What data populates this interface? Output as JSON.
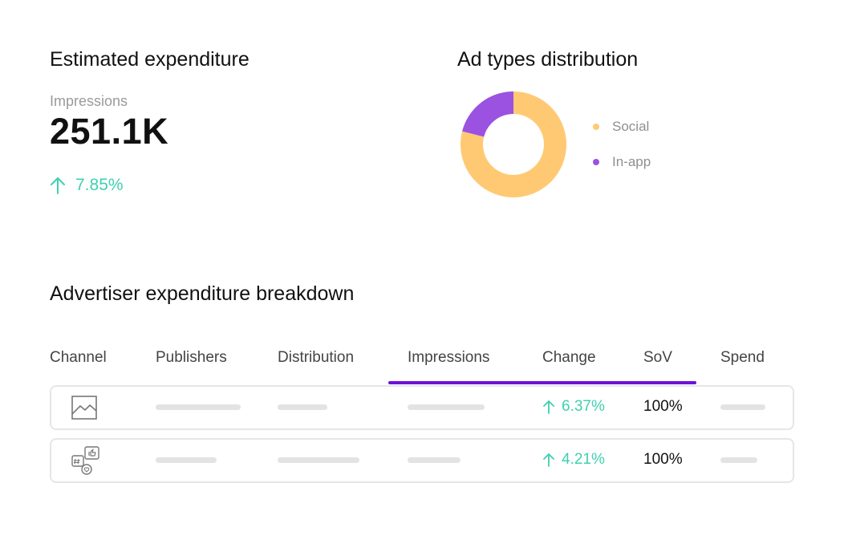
{
  "estimated": {
    "title": "Estimated expenditure",
    "metric_label": "Impressions",
    "metric_value": "251.1K",
    "change": "7.85%"
  },
  "ad_types": {
    "title": "Ad types distribution",
    "legend": [
      {
        "label": "Social",
        "color": "#ffc974",
        "share": 0.79
      },
      {
        "label": "In-app",
        "color": "#9b52e0",
        "share": 0.21
      }
    ]
  },
  "breakdown": {
    "title": "Advertiser expenditure breakdown",
    "columns": [
      "Channel",
      "Publishers",
      "Distribution",
      "Impressions",
      "Change",
      "SoV",
      "Spend"
    ],
    "active_column": "Impressions",
    "rows": [
      {
        "channel_icon": "image-icon",
        "change": "6.37%",
        "sov": "100%"
      },
      {
        "channel_icon": "social-icon",
        "change": "4.21%",
        "sov": "100%"
      }
    ]
  },
  "colors": {
    "accent": "#6e12d9",
    "positive": "#3fd0b0",
    "social": "#ffc974",
    "in_app": "#9b52e0"
  }
}
